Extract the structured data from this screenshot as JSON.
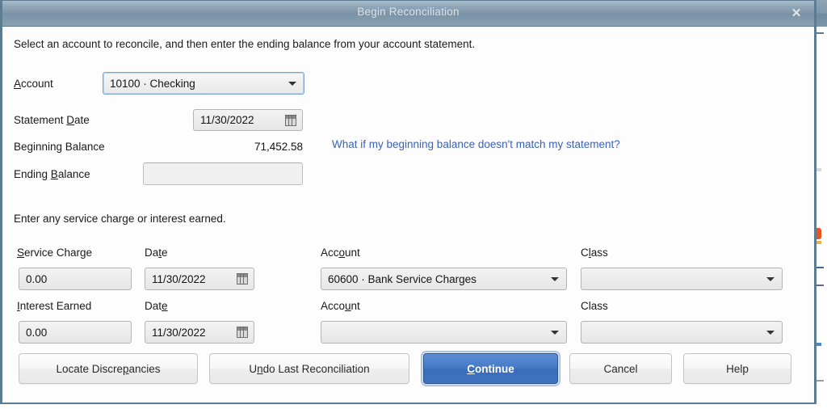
{
  "dialog": {
    "title": "Begin Reconciliation",
    "close_icon": "close-icon",
    "intro": "Select an account to reconcile, and then enter the ending balance from your account statement.",
    "section_note": "Enter any service charge or interest earned."
  },
  "account_section": {
    "account_label": "Account",
    "account_label_accel": "A",
    "account_value": "10100 · Checking",
    "statement_date_label": "Statement Date",
    "statement_date_accel": "D",
    "statement_date_value": "11/30/2022",
    "beginning_balance_label": "Beginning Balance",
    "beginning_balance_value": "71,452.58",
    "ending_balance_label": "Ending Balance",
    "ending_balance_accel": "B",
    "ending_balance_value": "",
    "ending_balance_placeholder": "",
    "help_link": "What if my beginning balance doesn't match my statement?",
    "link_color": "#3c62b5"
  },
  "charges": {
    "service_charge_label": "Service Charge",
    "service_charge_accel": "S",
    "service_charge_value": "0.00",
    "service_date_label": "Date",
    "service_date_accel": "t",
    "service_date_value": "11/30/2022",
    "service_account_label": "Account",
    "service_account_accel": "o",
    "service_account_value": "60600 · Bank Service Charges",
    "service_class_label": "Class",
    "service_class_accel": "l",
    "service_class_value": "",
    "interest_label": "Interest Earned",
    "interest_accel": "I",
    "interest_value": "0.00",
    "interest_date_label": "Date",
    "interest_date_accel": "e",
    "interest_date_value": "11/30/2022",
    "interest_account_label": "Account",
    "interest_account_accel": "u",
    "interest_account_value": "",
    "interest_class_label": "Class",
    "interest_class_value": ""
  },
  "buttons": {
    "locate": "Locate Discrepancies",
    "locate_accel": "p",
    "undo": "Undo Last Reconciliation",
    "undo_accel": "n",
    "continue": "Continue",
    "continue_accel": "C",
    "cancel": "Cancel",
    "help": "Help",
    "primary_color": "#4579c4"
  },
  "theme": {
    "titlebar_start": "#a9bcc9",
    "titlebar_end": "#8ba2b3",
    "dialog_border": "#5d7b91",
    "field_bg": "#ececec"
  }
}
